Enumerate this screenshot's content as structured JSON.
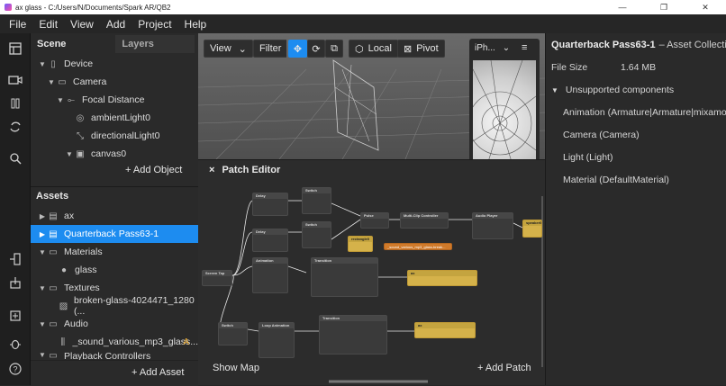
{
  "window": {
    "title": "ax glass - C:/Users/N/Documents/Spark AR/QB2",
    "minimize": "—",
    "restore": "❐",
    "close": "✕"
  },
  "menu": [
    "File",
    "Edit",
    "View",
    "Add",
    "Project",
    "Help"
  ],
  "scene": {
    "tab_scene": "Scene",
    "tab_layers": "Layers",
    "tree": [
      {
        "label": "Device",
        "icon": "device-icon"
      },
      {
        "label": "Camera",
        "icon": "camera-icon"
      },
      {
        "label": "Focal Distance",
        "icon": "focal-icon"
      },
      {
        "label": "ambientLight0",
        "icon": "ambient-light-icon"
      },
      {
        "label": "directionalLight0",
        "icon": "directional-light-icon"
      },
      {
        "label": "canvas0",
        "icon": "canvas-icon"
      }
    ],
    "add_object": "+ Add Object"
  },
  "assets": {
    "title": "Assets",
    "items": [
      {
        "label": "ax"
      },
      {
        "label": "Quarterback Pass63-1"
      },
      {
        "label": "Materials"
      },
      {
        "label": "glass"
      },
      {
        "label": "Textures"
      },
      {
        "label": "broken-glass-4024471_1280 (..."
      },
      {
        "label": "Audio"
      },
      {
        "label": "_sound_various_mp3_glass...",
        "badge": "A"
      },
      {
        "label": "Playback Controllers"
      }
    ],
    "add_asset": "+ Add Asset"
  },
  "viewport": {
    "view": "View",
    "filter": "Filter",
    "local": "Local",
    "pivot": "Pivot",
    "device": "iPh...",
    "chevron": "⌄"
  },
  "patch_editor": {
    "title": "Patch Editor",
    "close": "×",
    "show_map": "Show Map",
    "add_patch": "+ Add Patch",
    "nodes": {
      "delay1": "Delay",
      "switch1": "Switch",
      "delay2": "Delay",
      "switch2": "Switch",
      "pulse": "Pulse",
      "multiclip": "Multi-Clip Controller",
      "audio_player": "Audio Player",
      "speaker": "speaker0",
      "rectangle": "rectangle0",
      "sound_asset": "_sound_various_mp3_glass-break...",
      "animation": "Animation",
      "transition1": "Transition",
      "ax1": "ax",
      "screen_tap": "Screen Tap",
      "switch3": "Switch",
      "loop_animation": "Loop Animation",
      "transition2": "Transition",
      "ax2": "ax"
    }
  },
  "properties": {
    "title": "Quarterback Pass63-1",
    "subtitle": "– Asset Collection",
    "file_size_label": "File Size",
    "file_size_value": "1.64 MB",
    "unsupported": "Unsupported components",
    "components": [
      "Animation (Armature|Armature|mixamo.c...",
      "Camera (Camera)",
      "Light (Light)",
      "Material (DefaultMaterial)"
    ]
  }
}
